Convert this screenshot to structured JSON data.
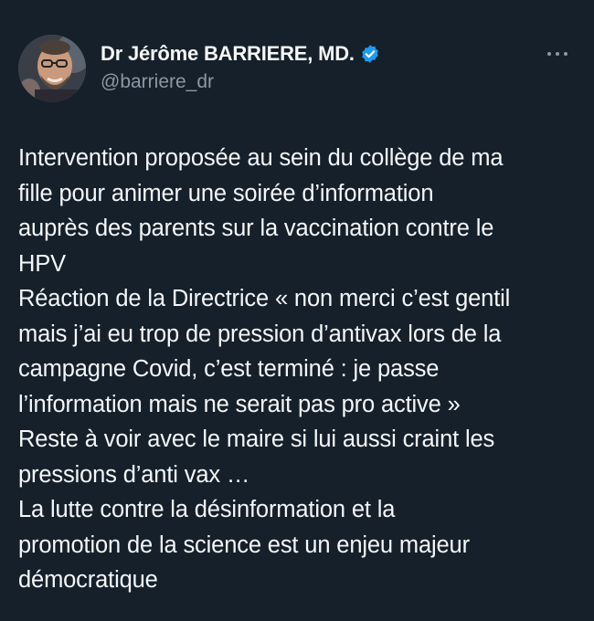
{
  "author": {
    "display_name": "Dr Jérôme BARRIERE, MD.",
    "handle": "@barriere_dr",
    "verified": true
  },
  "icons": {
    "avatar": "profile-photo",
    "badge": "verified-badge-icon",
    "more": "more-options-icon"
  },
  "colors": {
    "background": "#15202b",
    "text": "#f5f8fa",
    "secondary_text": "#8b98a5",
    "verified_blue": "#1d9bf0"
  },
  "tweet": {
    "lines": [
      "Intervention proposée au sein du collège de ma",
      "fille pour animer une soirée d’information",
      "auprès des parents sur la vaccination contre le",
      "HPV",
      "Réaction de la Directrice « non merci c’est gentil",
      "mais j’ai eu trop de pression d’antivax lors de la",
      "campagne Covid, c’est terminé : je passe",
      "l’information mais ne serait pas pro active »",
      "Reste à voir avec le maire si lui aussi craint les",
      "pressions d’anti vax …",
      "La lutte contre la désinformation et la",
      "promotion de la science est un enjeu majeur",
      "démocratique"
    ]
  }
}
